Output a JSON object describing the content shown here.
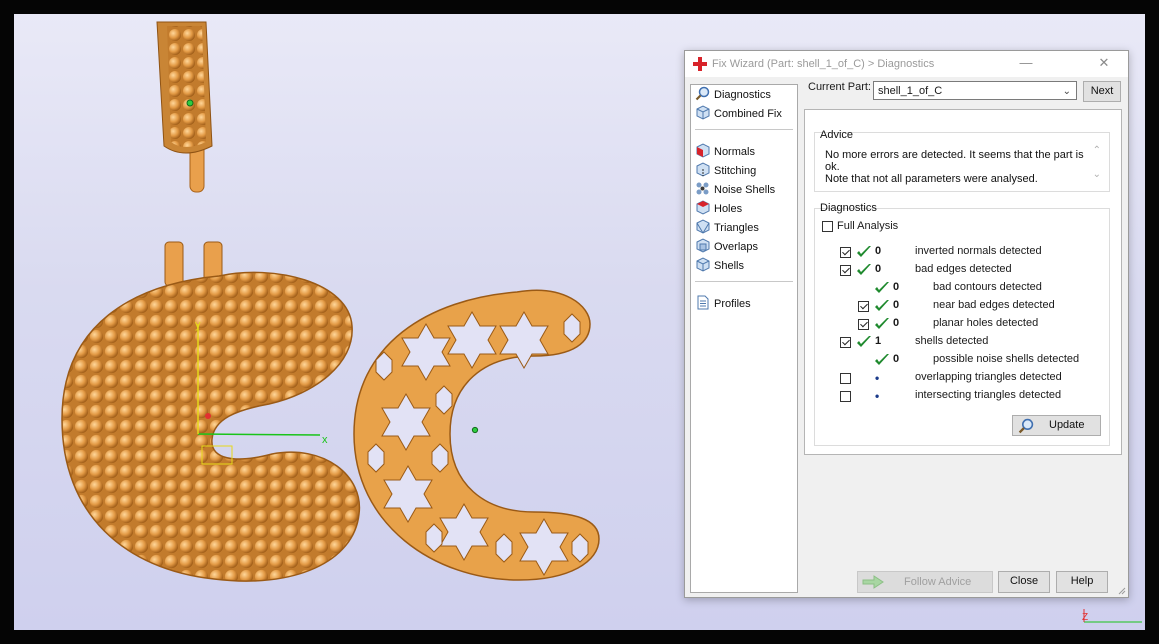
{
  "dialog": {
    "title": "Fix Wizard (Part: shell_1_of_C) > Diagnostics",
    "minimize": "—",
    "close": "✕",
    "current_part_label": "Current Part:",
    "current_part_value": "shell_1_of_C",
    "next_label": "Next",
    "nav": [
      {
        "label": "Diagnostics",
        "icon": "magnifier-icon"
      },
      {
        "label": "Combined Fix",
        "icon": "cube-icon"
      },
      {
        "label": "Normals",
        "icon": "normals-icon"
      },
      {
        "label": "Stitching",
        "icon": "stitching-icon"
      },
      {
        "label": "Noise Shells",
        "icon": "noise-shells-icon"
      },
      {
        "label": "Holes",
        "icon": "holes-icon"
      },
      {
        "label": "Triangles",
        "icon": "triangles-icon"
      },
      {
        "label": "Overlaps",
        "icon": "overlaps-icon"
      },
      {
        "label": "Shells",
        "icon": "shells-icon"
      },
      {
        "label": "Profiles",
        "icon": "document-icon"
      }
    ],
    "advice": {
      "title": "Advice",
      "line1": "No more errors are detected. It seems that the part is ok.",
      "line2": "Note that not all parameters were analysed."
    },
    "diagnostics": {
      "title": "Diagnostics",
      "full_analysis_label": "Full Analysis",
      "full_analysis_checked": false,
      "rows": [
        {
          "checkbox": true,
          "checked": true,
          "status": "ok",
          "count": "0",
          "label": "inverted normals detected",
          "indent": 0
        },
        {
          "checkbox": true,
          "checked": true,
          "status": "ok",
          "count": "0",
          "label": "bad edges detected",
          "indent": 0
        },
        {
          "checkbox": false,
          "checked": false,
          "status": "ok",
          "count": "0",
          "label": "bad contours detected",
          "indent": 1
        },
        {
          "checkbox": true,
          "checked": true,
          "status": "ok",
          "count": "0",
          "label": "near bad edges detected",
          "indent": 1
        },
        {
          "checkbox": true,
          "checked": true,
          "status": "ok",
          "count": "0",
          "label": "planar holes detected",
          "indent": 1
        },
        {
          "checkbox": true,
          "checked": true,
          "status": "ok",
          "count": "1",
          "label": "shells detected",
          "indent": 0
        },
        {
          "checkbox": false,
          "checked": false,
          "status": "ok",
          "count": "0",
          "label": "possible noise shells detected",
          "indent": 1
        },
        {
          "checkbox": true,
          "checked": false,
          "status": "none",
          "count": "•",
          "label": "overlapping triangles detected",
          "indent": 0
        },
        {
          "checkbox": true,
          "checked": false,
          "status": "none",
          "count": "•",
          "label": "intersecting triangles detected",
          "indent": 0
        }
      ],
      "update_label": "Update"
    },
    "footer": {
      "follow_advice_label": "Follow Advice",
      "close_label": "Close",
      "help_label": "Help"
    }
  },
  "viewport": {
    "axis_x_label": "x",
    "axis_y_label": "y"
  },
  "colors": {
    "gold": "#e8a24a",
    "gold_dark": "#b86a1a",
    "check_green": "#1f8a2e",
    "viewport_bg": "#d9daf0"
  }
}
